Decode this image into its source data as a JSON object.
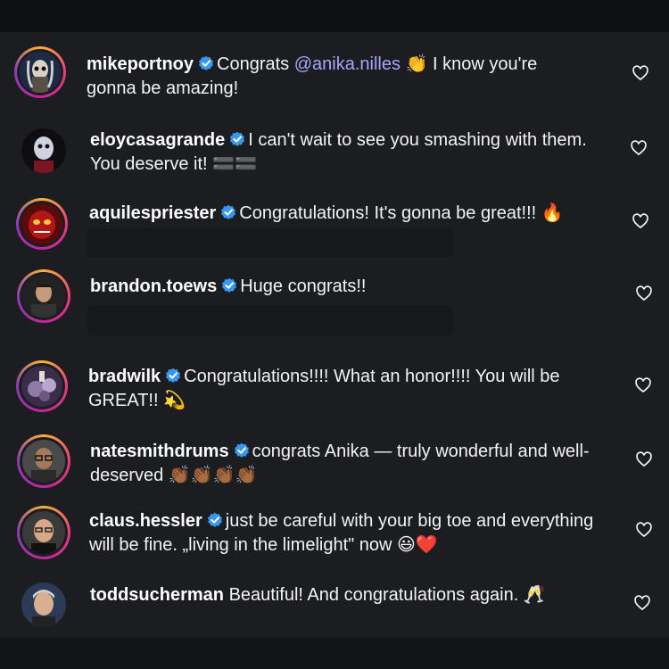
{
  "comments": [
    {
      "username": "mikeportnoy",
      "verified": true,
      "text_before": "Congrats",
      "mention": "@anika.nilles",
      "text_after": "👏 I know you're gonna be amazing!",
      "avatar_icon": "skull-avatar"
    },
    {
      "username": "eloycasagrande",
      "verified": true,
      "text": "I can't wait to see you smashing with them. You deserve it! 🟰🟰",
      "avatar_icon": "masked-avatar"
    },
    {
      "username": "aquilespriester",
      "verified": true,
      "text": "Congratulations! It's gonna be great!!! 🔥",
      "avatar_icon": "red-mask-avatar"
    },
    {
      "username": "brandon.toews",
      "verified": true,
      "text": "Huge congrats!!",
      "avatar_icon": "portrait-avatar"
    },
    {
      "username": "bradwilk",
      "verified": true,
      "text": "Congratulations!!!! What an honor!!!! You will be GREAT!! 💫",
      "avatar_icon": "drum-kit-avatar"
    },
    {
      "username": "natesmithdrums",
      "verified": true,
      "text": "congrats Anika — truly wonderful and well-deserved 👏🏾👏🏾👏🏾👏🏾",
      "avatar_icon": "glasses-avatar"
    },
    {
      "username": "claus.hessler",
      "verified": true,
      "text": "just be careful with your big toe and everything will be fine. „living in the limelight\" now 😃❤️",
      "avatar_icon": "bald-man-avatar"
    },
    {
      "username": "toddsucherman",
      "verified": false,
      "text": "Beautiful! And congratulations again. 🥂",
      "avatar_icon": "grey-hair-avatar"
    }
  ],
  "colors": {
    "background": "#1c1d21",
    "verified": "#3897f0",
    "mention": "#a7a5ff",
    "ring": "#e93a7d"
  }
}
